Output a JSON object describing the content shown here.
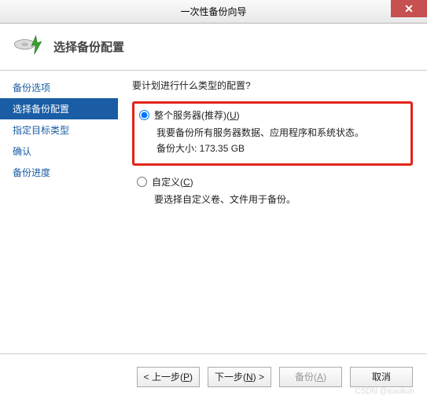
{
  "window": {
    "title": "一次性备份向导",
    "close_glyph": "✕"
  },
  "header": {
    "title": "选择备份配置"
  },
  "sidebar": {
    "items": [
      {
        "label": "备份选项"
      },
      {
        "label": "选择备份配置"
      },
      {
        "label": "指定目标类型"
      },
      {
        "label": "确认"
      },
      {
        "label": "备份进度"
      }
    ],
    "active_index": 1
  },
  "main": {
    "prompt": "要计划进行什么类型的配置?",
    "options": [
      {
        "label_prefix": "整个服务器(推荐)(",
        "accel": "U",
        "label_suffix": ")",
        "checked": true,
        "desc_lines": [
          "我要备份所有服务器数据、应用程序和系统状态。",
          "备份大小: 173.35 GB"
        ]
      },
      {
        "label_prefix": "自定义(",
        "accel": "C",
        "label_suffix": ")",
        "checked": false,
        "desc_lines": [
          "要选择自定义卷、文件用于备份。"
        ]
      }
    ]
  },
  "footer": {
    "back_prefix": "< 上一步(",
    "back_accel": "P",
    "back_suffix": ")",
    "next_prefix": "下一步(",
    "next_accel": "N",
    "next_suffix": ") >",
    "backup_prefix": "备份(",
    "backup_accel": "A",
    "backup_suffix": ")",
    "cancel": "取消"
  },
  "watermark": "CSDN @xiaokun"
}
